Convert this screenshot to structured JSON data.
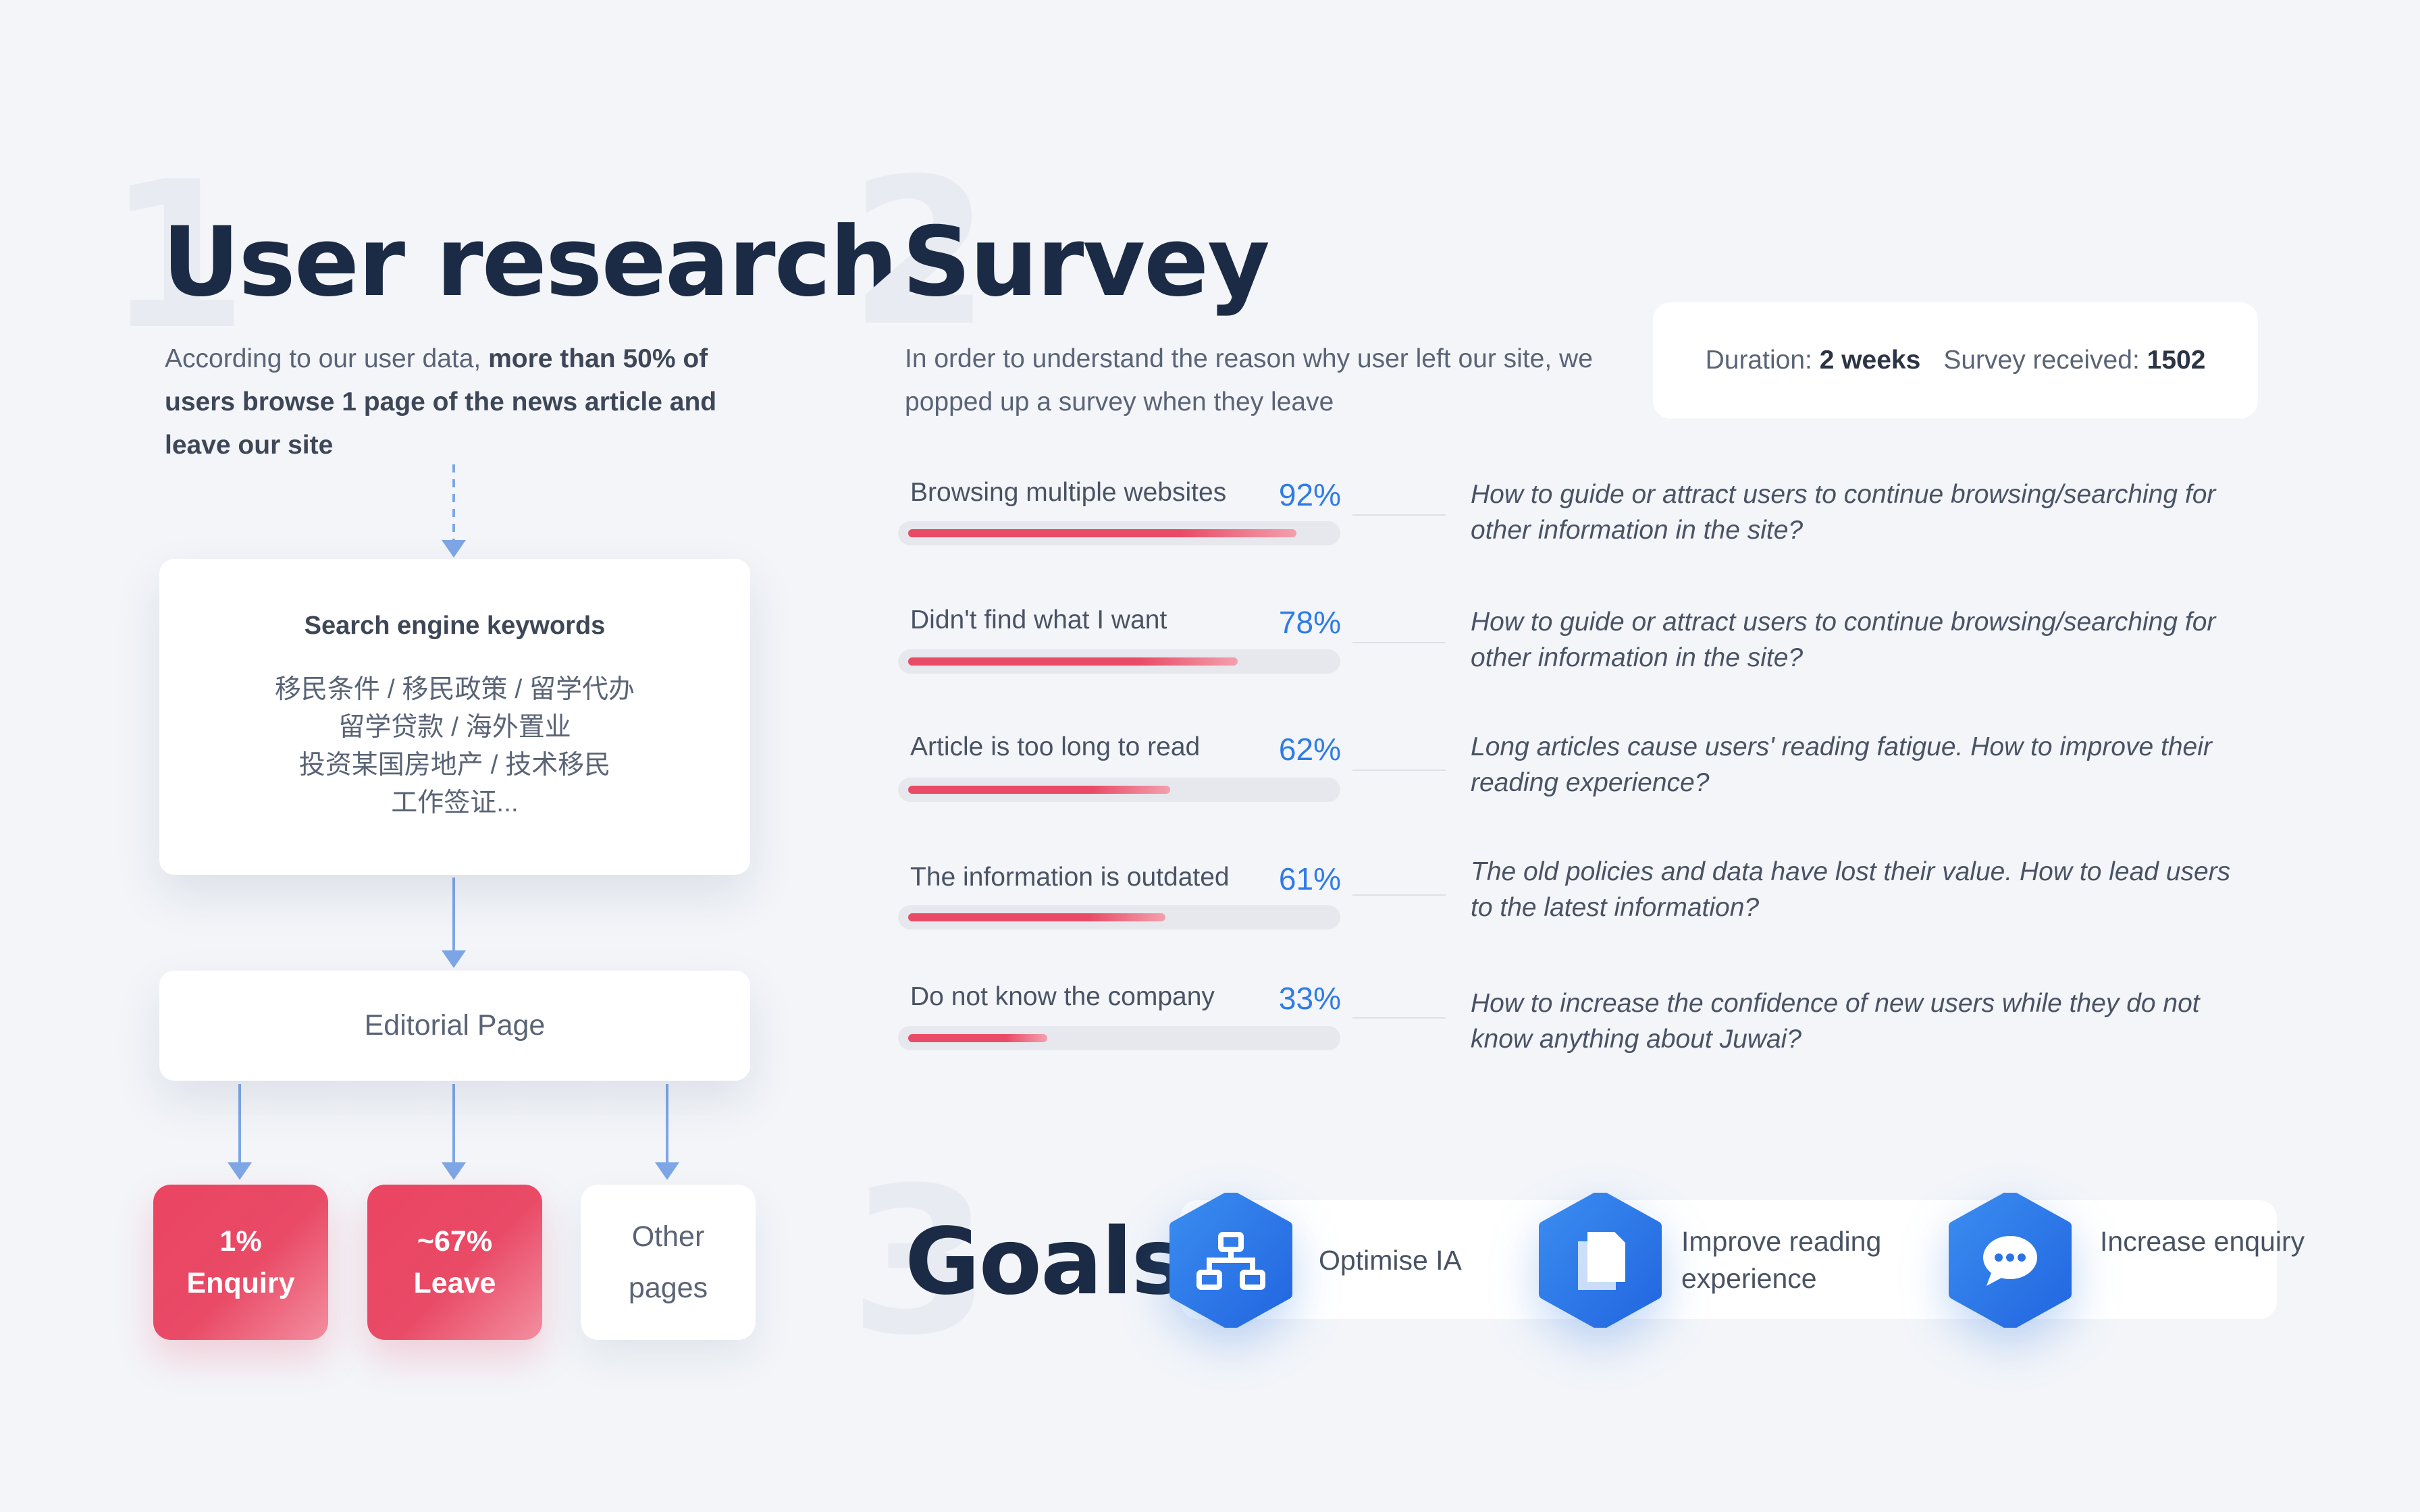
{
  "section1": {
    "number": "1",
    "title": "User research",
    "intro_plain": "According to our user data, ",
    "intro_bold": "more than 50% of users browse 1 page of the news article and leave our site",
    "keywords_card": {
      "title": "Search engine keywords",
      "lines": [
        "移民条件 / 移民政策 / 留学代办",
        "留学贷款 / 海外置业",
        "投资某国房地产 / 技术移民",
        "工作签证..."
      ]
    },
    "editorial_label": "Editorial Page",
    "outcomes": [
      {
        "line1": "1%",
        "line2": "Enquiry"
      },
      {
        "line1": "~67%",
        "line2": "Leave"
      },
      {
        "line1": "Other",
        "line2": "pages"
      }
    ]
  },
  "section2": {
    "number": "2",
    "title": "Survey",
    "intro": "In order to understand the reason why user left our site, we popped up a survey when they leave",
    "duration_label": "Duration:",
    "duration_value": "2 weeks",
    "received_label": "Survey received:",
    "received_value": "1502",
    "reasons": [
      {
        "label": "Browsing multiple websites",
        "percent": "92%",
        "value": 92,
        "question": "How to guide or attract users to continue browsing/searching for other information in the site?"
      },
      {
        "label": "Didn't find what I want",
        "percent": "78%",
        "value": 78,
        "question": "How to guide or attract users to continue browsing/searching for other information in the site?"
      },
      {
        "label": "Article is too long to read",
        "percent": "62%",
        "value": 62,
        "question": "Long articles cause users' reading fatigue. How to improve their reading experience?"
      },
      {
        "label": "The information is outdated",
        "percent": "61%",
        "value": 61,
        "question": "The old policies and data have lost their value. How to lead users to the latest information?"
      },
      {
        "label": "Do not know the company",
        "percent": "33%",
        "value": 33,
        "question": "How to increase the confidence of new users while they do not know anything about Juwai?"
      }
    ]
  },
  "section3": {
    "number": "3",
    "title": "Goals",
    "goals": [
      {
        "label": "Optimise IA",
        "icon": "sitemap-icon"
      },
      {
        "label": "Improve reading experience",
        "icon": "copy-icon"
      },
      {
        "label": "Increase enquiry",
        "icon": "chat-bubble-icon"
      }
    ]
  },
  "colors": {
    "accent_blue": "#2f7be6",
    "accent_red": "#e94a66",
    "title_navy": "#1b2b45",
    "background": "#f3f5f9"
  }
}
